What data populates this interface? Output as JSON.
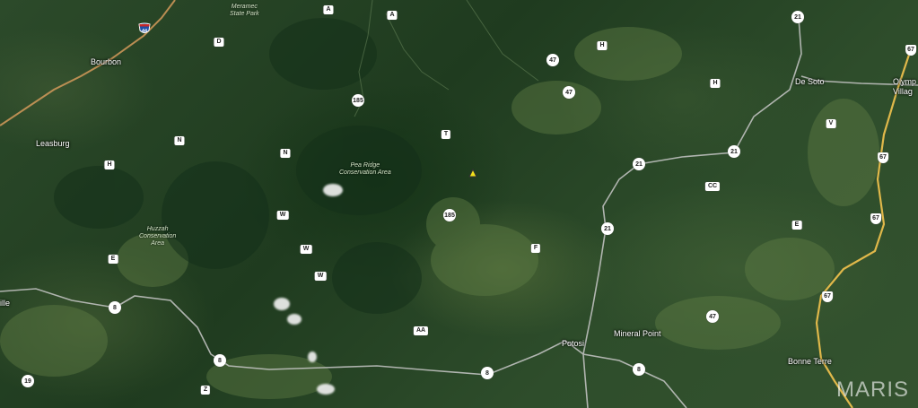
{
  "places": {
    "bourbon": "Bourbon",
    "leasburg": "Leasburg",
    "de_soto": "De Soto",
    "olympia_village": "Olymp\nVillag",
    "potosi": "Potosi",
    "mineral_point": "Mineral Point",
    "bonne_terre": "Bonne Terre",
    "ville": "ille"
  },
  "areas": {
    "meramec": "Meramec\nState Park",
    "pea_ridge": "Pea Ridge\nConservation Area",
    "huzzah": "Huzzah\nConservation\nArea"
  },
  "routes": {
    "i44": "44",
    "r185_a": "185",
    "r185_b": "185",
    "r21_a": "21",
    "r21_b": "21",
    "r21_c": "21",
    "r21_d": "21",
    "r47_a": "47",
    "r47_b": "47",
    "r47_c": "47",
    "r8_a": "8",
    "r8_b": "8",
    "r8_c": "8",
    "r8_d": "8",
    "r19": "19",
    "r67_a": "67",
    "r67_b": "67",
    "r67_c": "67",
    "r67_d": "67",
    "A1": "A",
    "A2": "A",
    "D": "D",
    "H1": "H",
    "H2": "H",
    "H3": "H",
    "N1": "N",
    "N2": "N",
    "T": "T",
    "V": "V",
    "CC": "CC",
    "W1": "W",
    "W2": "W",
    "W3": "W",
    "E1": "E",
    "E2": "E",
    "F": "F",
    "AA": "AA",
    "Z": "Z"
  },
  "watermark": "MARIS",
  "colors": {
    "road": "#c8c8c8",
    "interstate_road": "#d49a5a",
    "highway_67": "#e0b84a",
    "marker": "#f2e21a"
  },
  "icons": {
    "interstate": "interstate-shield-icon",
    "marker": "triangle-marker-icon"
  }
}
